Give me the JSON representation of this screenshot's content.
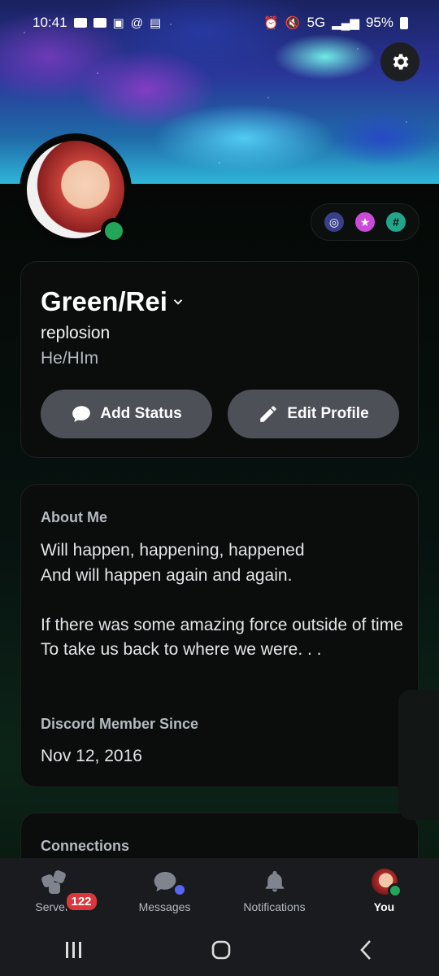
{
  "status_bar": {
    "time": "10:41",
    "network": "5G",
    "battery": "95%"
  },
  "profile": {
    "display_name": "Green/Rei",
    "username": "replosion",
    "pronouns": "He/HIm",
    "presence_color": "#23a55a"
  },
  "actions": {
    "add_status": "Add Status",
    "edit_profile": "Edit Profile"
  },
  "about": {
    "title": "About Me",
    "text": "Will happen, happening, happened\nAnd will happen again and again.\n\nIf there was some amazing force outside of time\nTo take us back to where we were. . .",
    "member_since_title": "Discord Member Since",
    "member_since": "Nov 12, 2016"
  },
  "connections": {
    "title": "Connections"
  },
  "nav": {
    "servers": "Servers",
    "servers_badge": "122",
    "messages": "Messages",
    "notifications": "Notifications",
    "you": "You"
  },
  "colors": {
    "accent": "#5865f2",
    "badge_red": "#da373c",
    "online": "#23a55a"
  }
}
